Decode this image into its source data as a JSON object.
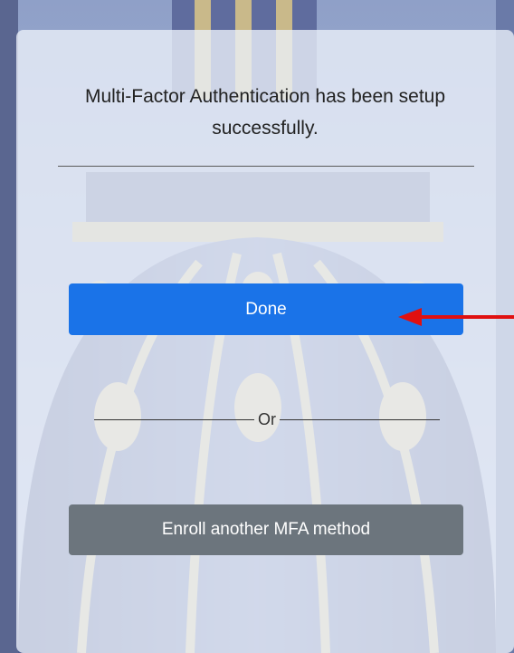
{
  "dialog": {
    "message": "Multi-Factor Authentication has been setup successfully.",
    "separator_text": "Or"
  },
  "buttons": {
    "done_label": "Done",
    "enroll_label": "Enroll another MFA method"
  },
  "colors": {
    "primary_button": "#1a73e8",
    "secondary_button": "#6c757d",
    "annotation_arrow": "#e01010"
  },
  "icons": {
    "annotation": "red-arrow-left"
  }
}
